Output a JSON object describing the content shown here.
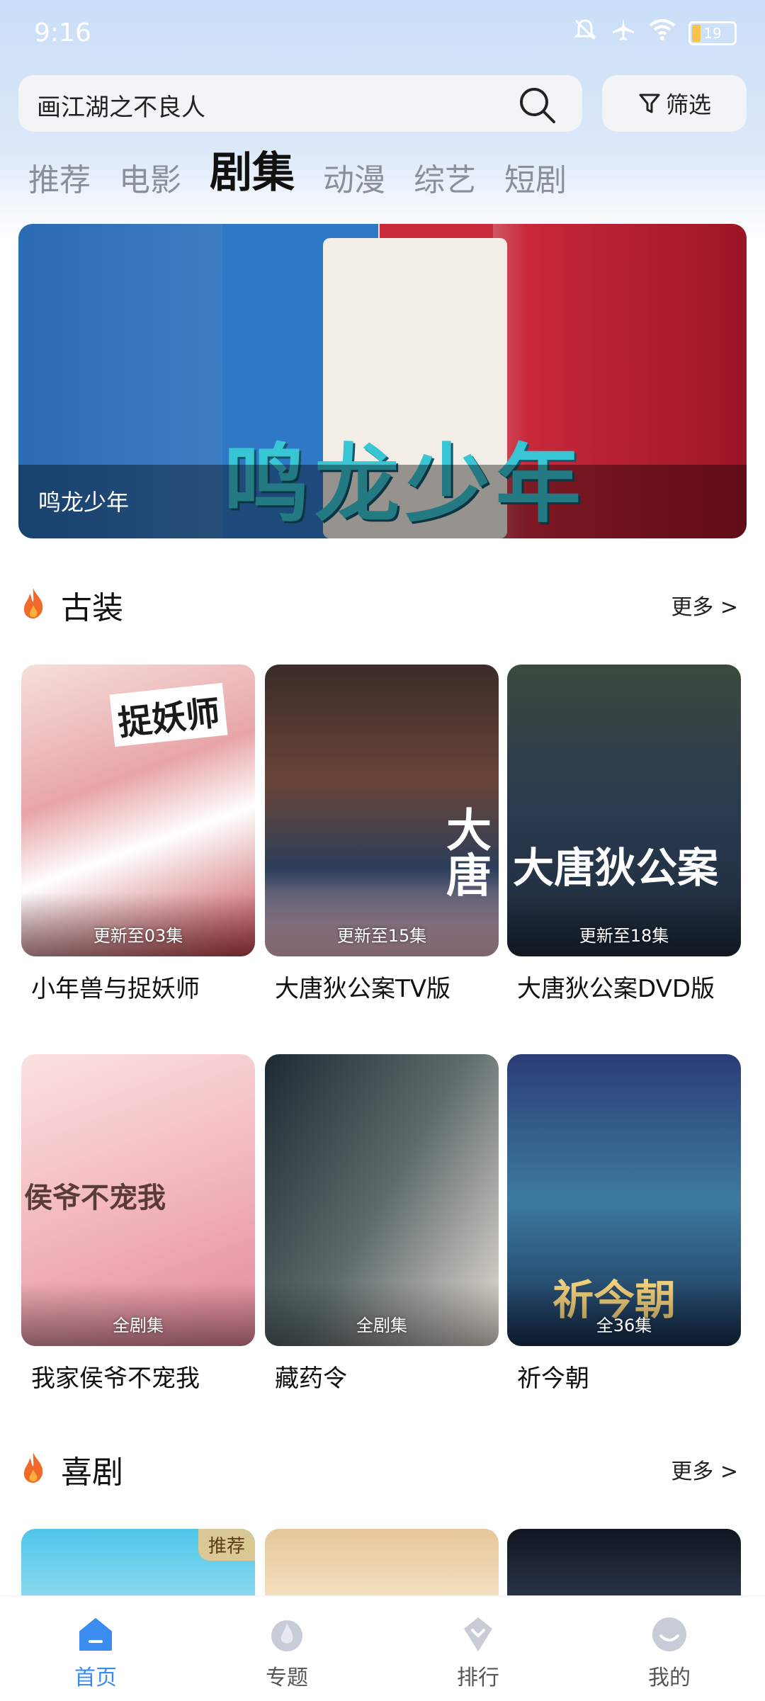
{
  "status_bar": {
    "time": "9:16",
    "battery": "19"
  },
  "search": {
    "query": "画江湖之不良人",
    "filter_label": "筛选"
  },
  "tabs": [
    "推荐",
    "电影",
    "剧集",
    "动漫",
    "综艺",
    "短剧"
  ],
  "active_tab": "剧集",
  "banner": {
    "caption": "鸣龙少年",
    "art_text": "鸣龙少年"
  },
  "sections": [
    {
      "title": "古装",
      "more": "更多 >",
      "items": [
        {
          "name": "小年兽与捉妖师",
          "badge": "更新至03集",
          "art": "捉妖师"
        },
        {
          "name": "大唐狄公案TV版",
          "badge": "更新至15集",
          "art": "大唐"
        },
        {
          "name": "大唐狄公案DVD版",
          "badge": "更新至18集",
          "art": "大唐狄公案"
        },
        {
          "name": "我家侯爷不宠我",
          "badge": "全剧集",
          "art": "侯爷不宠我"
        },
        {
          "name": "藏药令",
          "badge": "全剧集",
          "art": ""
        },
        {
          "name": "祈今朝",
          "badge": "全36集",
          "art": "祈今朝"
        }
      ]
    },
    {
      "title": "喜剧",
      "more": "更多 >",
      "items": [
        {
          "badge": "推荐"
        },
        {
          "badge": ""
        },
        {
          "badge": ""
        }
      ]
    }
  ],
  "bottom_nav": [
    {
      "label": "首页",
      "icon": "home-icon",
      "active": true
    },
    {
      "label": "专题",
      "icon": "topic-icon",
      "active": false
    },
    {
      "label": "排行",
      "icon": "ranking-icon",
      "active": false
    },
    {
      "label": "我的",
      "icon": "profile-icon",
      "active": false
    }
  ],
  "colors": {
    "accent": "#3a8cf0",
    "fire": "#f26a2a"
  }
}
